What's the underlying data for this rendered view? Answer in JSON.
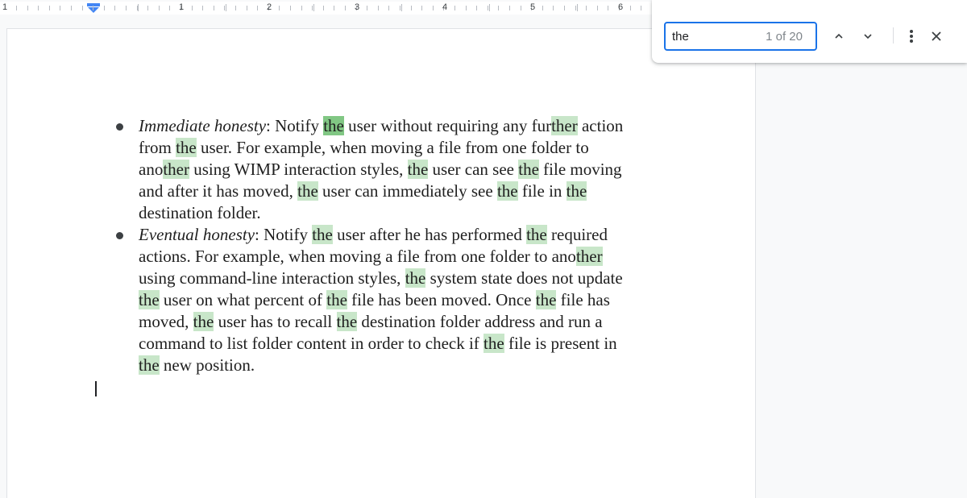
{
  "ruler": {
    "left_label": "1",
    "numbers": [
      "1",
      "2",
      "3",
      "4",
      "5",
      "6"
    ]
  },
  "find": {
    "query": "the",
    "match_count": "1 of 20",
    "icons": {
      "prev": "chevron-up-icon",
      "next": "chevron-down-icon",
      "more": "more-vert-icon",
      "close": "close-icon"
    }
  },
  "colors": {
    "match_highlight": "#c8e6c9",
    "current_match_highlight": "#81c784",
    "focus_border": "#1a73e8"
  },
  "document": {
    "bullets": [
      {
        "lines": [
          [
            {
              "t": "Immediate honesty",
              "i": true
            },
            {
              "t": ": Notify "
            },
            {
              "t": "the",
              "h": "cur"
            },
            {
              "t": " user without requiring any fur"
            },
            {
              "t": "ther",
              "h": "m"
            },
            {
              "t": " action"
            }
          ],
          [
            {
              "t": "from "
            },
            {
              "t": "the",
              "h": "m"
            },
            {
              "t": " user. For example, when moving a file from one folder to"
            }
          ],
          [
            {
              "t": "ano"
            },
            {
              "t": "ther",
              "h": "m"
            },
            {
              "t": " using WIMP interaction styles, "
            },
            {
              "t": "the",
              "h": "m"
            },
            {
              "t": " user can see "
            },
            {
              "t": "the",
              "h": "m"
            },
            {
              "t": " file moving"
            }
          ],
          [
            {
              "t": "and after it has moved, "
            },
            {
              "t": "the",
              "h": "m"
            },
            {
              "t": " user can immediately see "
            },
            {
              "t": "the",
              "h": "m"
            },
            {
              "t": " file in "
            },
            {
              "t": "the",
              "h": "m"
            }
          ],
          [
            {
              "t": "destination folder."
            }
          ]
        ]
      },
      {
        "lines": [
          [
            {
              "t": "Eventual honesty",
              "i": true
            },
            {
              "t": ": Notify "
            },
            {
              "t": "the",
              "h": "m"
            },
            {
              "t": " user after he has performed "
            },
            {
              "t": "the",
              "h": "m"
            },
            {
              "t": " required"
            }
          ],
          [
            {
              "t": "actions. For example, when moving a file from one folder to ano"
            },
            {
              "t": "ther",
              "h": "m"
            }
          ],
          [
            {
              "t": "using command-line interaction styles, "
            },
            {
              "t": "the",
              "h": "m"
            },
            {
              "t": " system state does not update"
            }
          ],
          [
            {
              "t": "the",
              "h": "m"
            },
            {
              "t": " user on what percent of "
            },
            {
              "t": "the",
              "h": "m"
            },
            {
              "t": " file has been moved. Once "
            },
            {
              "t": "the",
              "h": "m"
            },
            {
              "t": " file has"
            }
          ],
          [
            {
              "t": "moved, "
            },
            {
              "t": "the",
              "h": "m"
            },
            {
              "t": " user has to recall "
            },
            {
              "t": "the",
              "h": "m"
            },
            {
              "t": " destination folder address and run a"
            }
          ],
          [
            {
              "t": "command to list folder content in order to check if "
            },
            {
              "t": "the",
              "h": "m"
            },
            {
              "t": " file is present in"
            }
          ],
          [
            {
              "t": "the",
              "h": "m"
            },
            {
              "t": " new position."
            }
          ]
        ]
      }
    ]
  }
}
